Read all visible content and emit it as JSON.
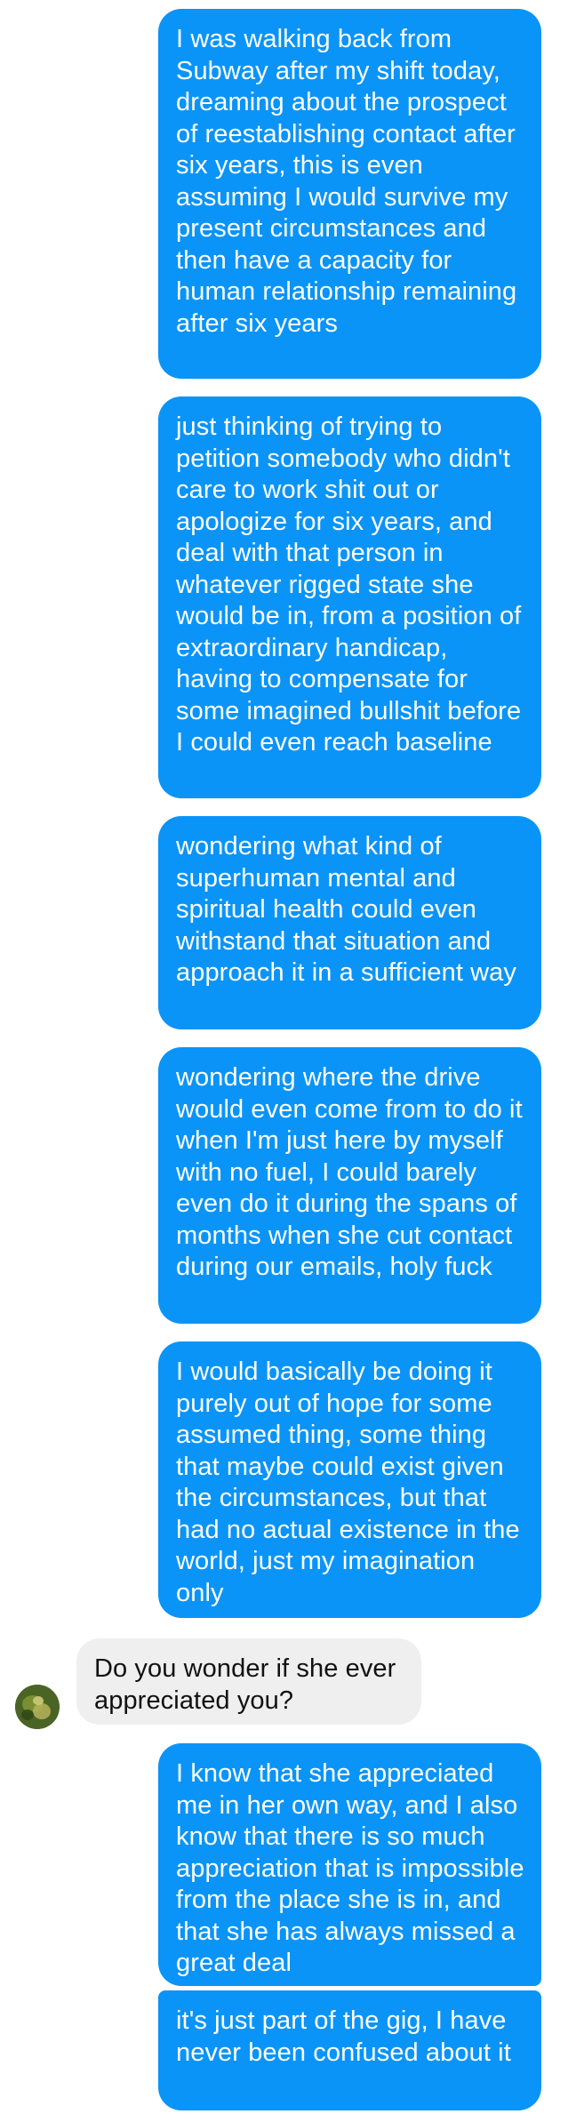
{
  "conversation": {
    "messages": [
      {
        "side": "sent",
        "text": "I was walking back from Subway after my shift today, dreaming about the prospect of reestablishing contact after six years, this is even assuming I would survive my present circumstances and then have a capacity for human relationship remaining after six years"
      },
      {
        "side": "sent",
        "text": "just thinking of trying to petition somebody who didn't care to work shit out or apologize for six years, and deal with that person in whatever rigged state she would be in, from a position of extraordinary handicap, having to compensate for some imagined bullshit before I could even reach baseline"
      },
      {
        "side": "sent",
        "text": "wondering what kind of superhuman mental and spiritual health could even withstand that situation and approach it in a sufficient way"
      },
      {
        "side": "sent",
        "text": "wondering where the drive would even come from to do it when I'm just here by myself with no fuel, I could barely even do it during the spans of months when she cut contact during our emails, holy fuck"
      },
      {
        "side": "sent",
        "text": "I would basically be doing it purely out of hope for some assumed thing, some thing that maybe could exist given the circumstances, but that had no actual existence in the world, just my imagination only"
      },
      {
        "side": "received",
        "text": "Do you wonder if she ever appreciated you?"
      },
      {
        "side": "sent",
        "text": "I know that she appreciated me in her own way, and I also know that there is so much appreciation that is impossible from the place she is in, and that she has always missed a great deal"
      },
      {
        "side": "sent",
        "text": "it's just part of the gig, I have never been confused about it"
      }
    ]
  },
  "colors": {
    "sent_bubble": "#0a94f7",
    "received_bubble": "#efefef",
    "background": "#ffffff"
  }
}
